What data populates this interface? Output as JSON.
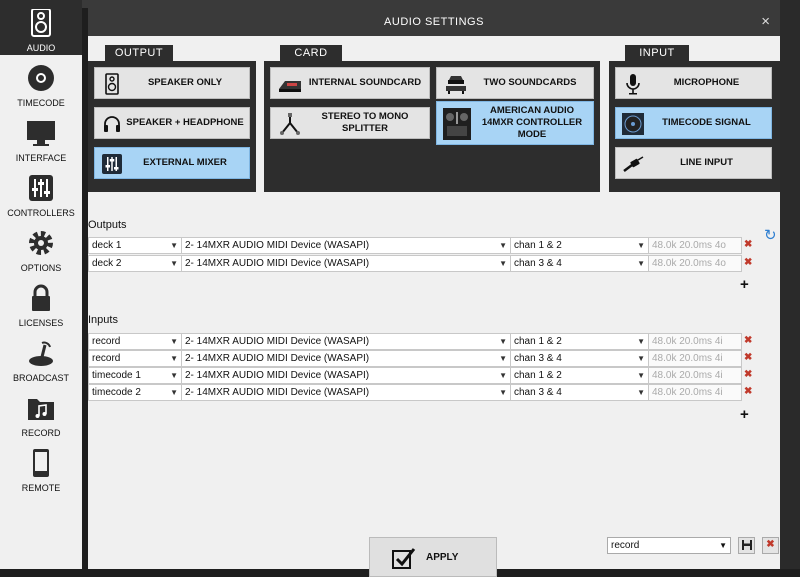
{
  "sidebar": {
    "items": [
      {
        "label": "AUDIO",
        "icon": "speaker-icon",
        "active": true
      },
      {
        "label": "TIMECODE",
        "icon": "vinyl-icon"
      },
      {
        "label": "INTERFACE",
        "icon": "monitor-icon"
      },
      {
        "label": "CONTROLLERS",
        "icon": "sliders-icon"
      },
      {
        "label": "OPTIONS",
        "icon": "gear-icon"
      },
      {
        "label": "LICENSES",
        "icon": "lock-icon"
      },
      {
        "label": "BROADCAST",
        "icon": "broadcast-icon"
      },
      {
        "label": "RECORD",
        "icon": "music-folder-icon"
      },
      {
        "label": "REMOTE",
        "icon": "phone-icon"
      }
    ]
  },
  "dialog": {
    "title": "AUDIO SETTINGS",
    "close": "×"
  },
  "sections": {
    "output": {
      "label": "OUTPUT",
      "buttons": [
        {
          "label": "SPEAKER ONLY",
          "icon": "speaker-icon"
        },
        {
          "label": "SPEAKER + HEADPHONE",
          "icon": "headphone-icon"
        },
        {
          "label": "EXTERNAL MIXER",
          "icon": "mixer-icon",
          "selected": true
        }
      ]
    },
    "card": {
      "label": "CARD",
      "buttons": [
        {
          "label": "INTERNAL SOUNDCARD",
          "icon": "soundcard-icon"
        },
        {
          "label": "TWO SOUNDCARDS",
          "icon": "two-soundcards-icon"
        },
        {
          "label": "STEREO TO MONO SPLITTER",
          "icon": "splitter-cable-icon"
        },
        {
          "label": "AMERICAN AUDIO 14MXR CONTROLLER MODE",
          "icon": "controller-icon",
          "selected": true
        }
      ]
    },
    "input": {
      "label": "INPUT",
      "buttons": [
        {
          "label": "MICROPHONE",
          "icon": "microphone-icon"
        },
        {
          "label": "TIMECODE SIGNAL",
          "icon": "timecode-disc-icon",
          "selected": true
        },
        {
          "label": "LINE INPUT",
          "icon": "jack-cable-icon"
        }
      ]
    }
  },
  "outputs": {
    "label": "Outputs",
    "rows": [
      {
        "name": "deck 1",
        "device": "2- 14MXR AUDIO MIDI Device (WASAPI)",
        "channels": "chan 1 & 2",
        "info": "48.0k 20.0ms 4o"
      },
      {
        "name": "deck 2",
        "device": "2- 14MXR AUDIO MIDI Device (WASAPI)",
        "channels": "chan 3 & 4",
        "info": "48.0k 20.0ms 4o"
      }
    ]
  },
  "inputs": {
    "label": "Inputs",
    "rows": [
      {
        "name": "record",
        "device": "2- 14MXR AUDIO MIDI Device (WASAPI)",
        "channels": "chan 1 & 2",
        "info": "48.0k 20.0ms 4i"
      },
      {
        "name": "record",
        "device": "2- 14MXR AUDIO MIDI Device (WASAPI)",
        "channels": "chan 3 & 4",
        "info": "48.0k 20.0ms 4i"
      },
      {
        "name": "timecode 1",
        "device": "2- 14MXR AUDIO MIDI Device (WASAPI)",
        "channels": "chan 1 & 2",
        "info": "48.0k 20.0ms 4i"
      },
      {
        "name": "timecode 2",
        "device": "2- 14MXR AUDIO MIDI Device (WASAPI)",
        "channels": "chan 3 & 4",
        "info": "48.0k 20.0ms 4i"
      }
    ]
  },
  "footer": {
    "apply_label": "APPLY",
    "preset_value": "record"
  },
  "colors": {
    "selected": "#a8d4f5",
    "dark_panel": "#2d2d2d",
    "delete": "#c0392b"
  }
}
